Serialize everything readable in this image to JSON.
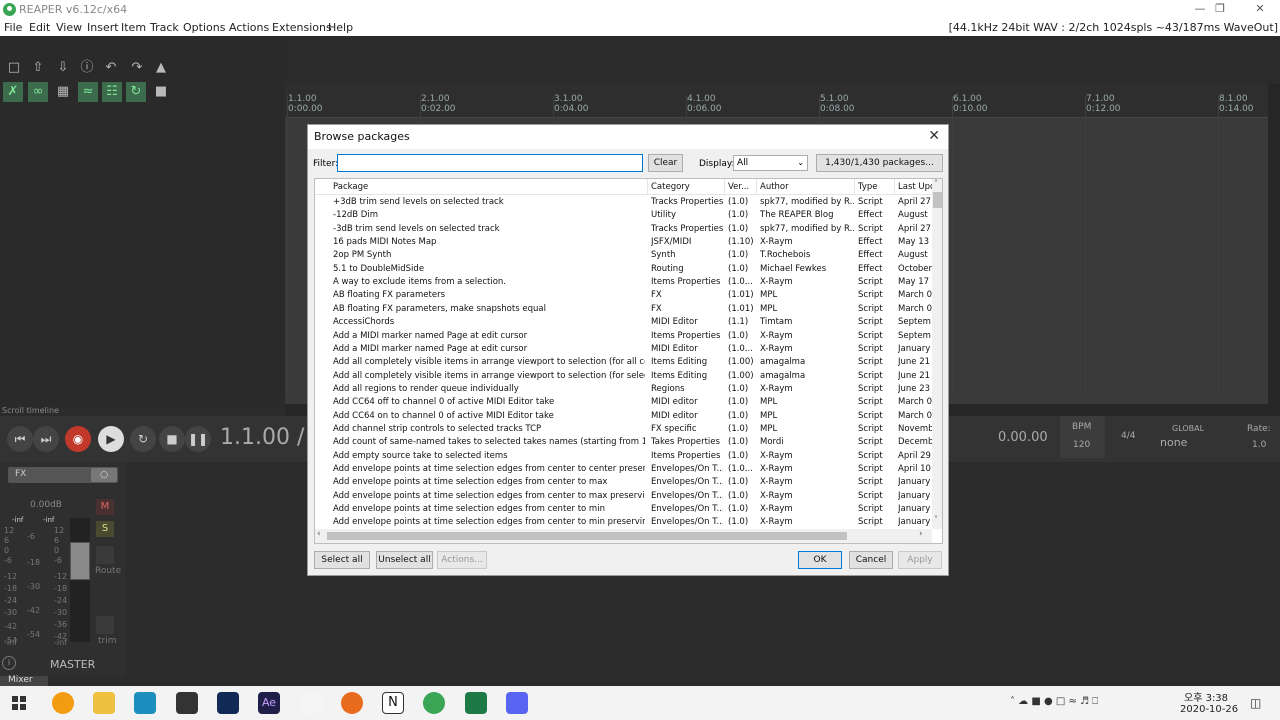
{
  "window": {
    "title": "REAPER v6.12c/x64",
    "status": "[44.1kHz 24bit WAV : 2/2ch 1024spls ~43/187ms WaveOut]",
    "controls": [
      "—",
      "❐",
      "✕"
    ]
  },
  "menu": [
    "File",
    "Edit",
    "View",
    "Insert",
    "Item",
    "Track",
    "Options",
    "Actions",
    "Extensions",
    "Help"
  ],
  "ruler": [
    {
      "bar": "1.1.00",
      "time": "0:00.00"
    },
    {
      "bar": "2.1.00",
      "time": "0:02.00"
    },
    {
      "bar": "3.1.00",
      "time": "0:04.00"
    },
    {
      "bar": "4.1.00",
      "time": "0:06.00"
    },
    {
      "bar": "5.1.00",
      "time": "0:08.00"
    },
    {
      "bar": "6.1.00",
      "time": "0:10.00"
    },
    {
      "bar": "7.1.00",
      "time": "0:12.00"
    },
    {
      "bar": "8.1.00",
      "time": "0:14.00"
    }
  ],
  "transport": {
    "time": "1.1.00 /",
    "position2": "0.00.00",
    "bpm_label": "BPM",
    "bpm": "120",
    "signature": "4/4",
    "global": "GLOBAL",
    "global_value": "none",
    "rate_label": "Rate:",
    "rate": "1.0",
    "scroll_label": "Scroll timeline"
  },
  "mixer": {
    "fx_label": "FX",
    "volume": "0.00dB",
    "inf_l": "-inf",
    "inf_r": "-inf",
    "m": "M",
    "s": "S",
    "route": "Route",
    "trim": "trim",
    "master": "MASTER",
    "tab": "Mixer",
    "scale_l": [
      "12",
      "6",
      "0",
      "-6",
      "-12",
      "-18",
      "-24",
      "-30",
      "-42",
      "-54",
      "-inf"
    ],
    "scale_m": [
      "-6",
      "-18",
      "-30",
      "-42",
      "-54"
    ],
    "scale_r": [
      "12",
      "6",
      "0",
      "-6",
      "-12",
      "-18",
      "-24",
      "-30",
      "-36",
      "-42",
      "-inf"
    ]
  },
  "dialog": {
    "title": "Browse packages",
    "filter_label": "Filter:",
    "filter_value": "",
    "clear_label": "Clear",
    "display_label": "Display:",
    "display_value": "All",
    "packages_button": "1,430/1,430 packages...",
    "columns": [
      "Package",
      "Category",
      "Ver...",
      "Author",
      "Type",
      "Last Upd"
    ],
    "rows": [
      [
        "+3dB trim send levels on selected track",
        "Tracks Properties",
        "(1.0)",
        "spk77, modified by R...",
        "Script",
        "April 27"
      ],
      [
        "-12dB Dim",
        "Utility",
        "(1.0)",
        "The REAPER Blog",
        "Effect",
        "August"
      ],
      [
        "-3dB trim send levels on selected track",
        "Tracks Properties",
        "(1.0)",
        "spk77, modified by R...",
        "Script",
        "April 27"
      ],
      [
        "16 pads MIDI Notes Map",
        "JSFX/MIDI",
        "(1.10)",
        "X-Raym",
        "Effect",
        "May 13"
      ],
      [
        "2op PM Synth",
        "Synth",
        "(1.0)",
        "T.Rochebois",
        "Effect",
        "August"
      ],
      [
        "5.1 to DoubleMidSide",
        "Routing",
        "(1.0)",
        "Michael Fewkes",
        "Effect",
        "October"
      ],
      [
        "A way to exclude items from a selection.",
        "Items Properties",
        "(1.0...",
        "X-Raym",
        "Script",
        "May 17"
      ],
      [
        "AB floating FX parameters",
        "FX",
        "(1.01)",
        "MPL",
        "Script",
        "March 0"
      ],
      [
        "AB floating FX parameters, make snapshots equal",
        "FX",
        "(1.01)",
        "MPL",
        "Script",
        "March 0"
      ],
      [
        "AccessiChords",
        "MIDI Editor",
        "(1.1)",
        "Timtam",
        "Script",
        "Septem"
      ],
      [
        "Add a MIDI marker named Page at edit cursor",
        "Items Properties",
        "(1.0)",
        "X-Raym",
        "Script",
        "Septem"
      ],
      [
        "Add a MIDI marker named Page at edit cursor",
        "MIDI Editor",
        "(1.0...",
        "X-Raym",
        "Script",
        "January"
      ],
      [
        "Add all completely visible items in arrange viewport to selection (for all complet...",
        "Items Editing",
        "(1.00)",
        "amagalma",
        "Script",
        "June 21"
      ],
      [
        "Add all completely visible items in arrange viewport to selection (for selected tr...",
        "Items Editing",
        "(1.00)",
        "amagalma",
        "Script",
        "June 21"
      ],
      [
        "Add all regions to render queue individually",
        "Regions",
        "(1.0)",
        "X-Raym",
        "Script",
        "June 23"
      ],
      [
        "Add CC64 off to channel 0 of active MIDI Editor take",
        "MIDI editor",
        "(1.0)",
        "MPL",
        "Script",
        "March 0"
      ],
      [
        "Add CC64 on to channel 0 of active MIDI Editor take",
        "MIDI editor",
        "(1.0)",
        "MPL",
        "Script",
        "March 0"
      ],
      [
        "Add channel strip controls to selected tracks TCP",
        "FX specific",
        "(1.0)",
        "MPL",
        "Script",
        "Novemb"
      ],
      [
        "Add count of same-named takes to selected takes names (starting from 1)",
        "Takes Properties",
        "(1.0)",
        "Mordi",
        "Script",
        "Decemb"
      ],
      [
        "Add empty source take to selected items",
        "Items Properties",
        "(1.0)",
        "X-Raym",
        "Script",
        "April 29"
      ],
      [
        "Add envelope points at time selection edges from center to center preserving e...",
        "Envelopes/On T...",
        "(1.0...",
        "X-Raym",
        "Script",
        "April 10"
      ],
      [
        "Add envelope points at time selection edges from center to max",
        "Envelopes/On T...",
        "(1.0)",
        "X-Raym",
        "Script",
        "January"
      ],
      [
        "Add envelope points at time selection edges from center to max preserving edg...",
        "Envelopes/On T...",
        "(1.0)",
        "X-Raym",
        "Script",
        "January"
      ],
      [
        "Add envelope points at time selection edges from center to min",
        "Envelopes/On T...",
        "(1.0)",
        "X-Raym",
        "Script",
        "January"
      ],
      [
        "Add envelope points at time selection edges from center to min preserving edges",
        "Envelopes/On T...",
        "(1.0)",
        "X-Raym",
        "Script",
        "January"
      ]
    ],
    "select_all": "Select all",
    "unselect_all": "Unselect all",
    "actions": "Actions...",
    "ok": "OK",
    "cancel": "Cancel",
    "apply": "Apply"
  },
  "taskbar": {
    "time": "오후 3:38",
    "date": "2020-10-26"
  },
  "colors": {
    "reaper_green": "#3aa555",
    "accent_blue": "#0078d7",
    "record_red": "#c0392b"
  }
}
